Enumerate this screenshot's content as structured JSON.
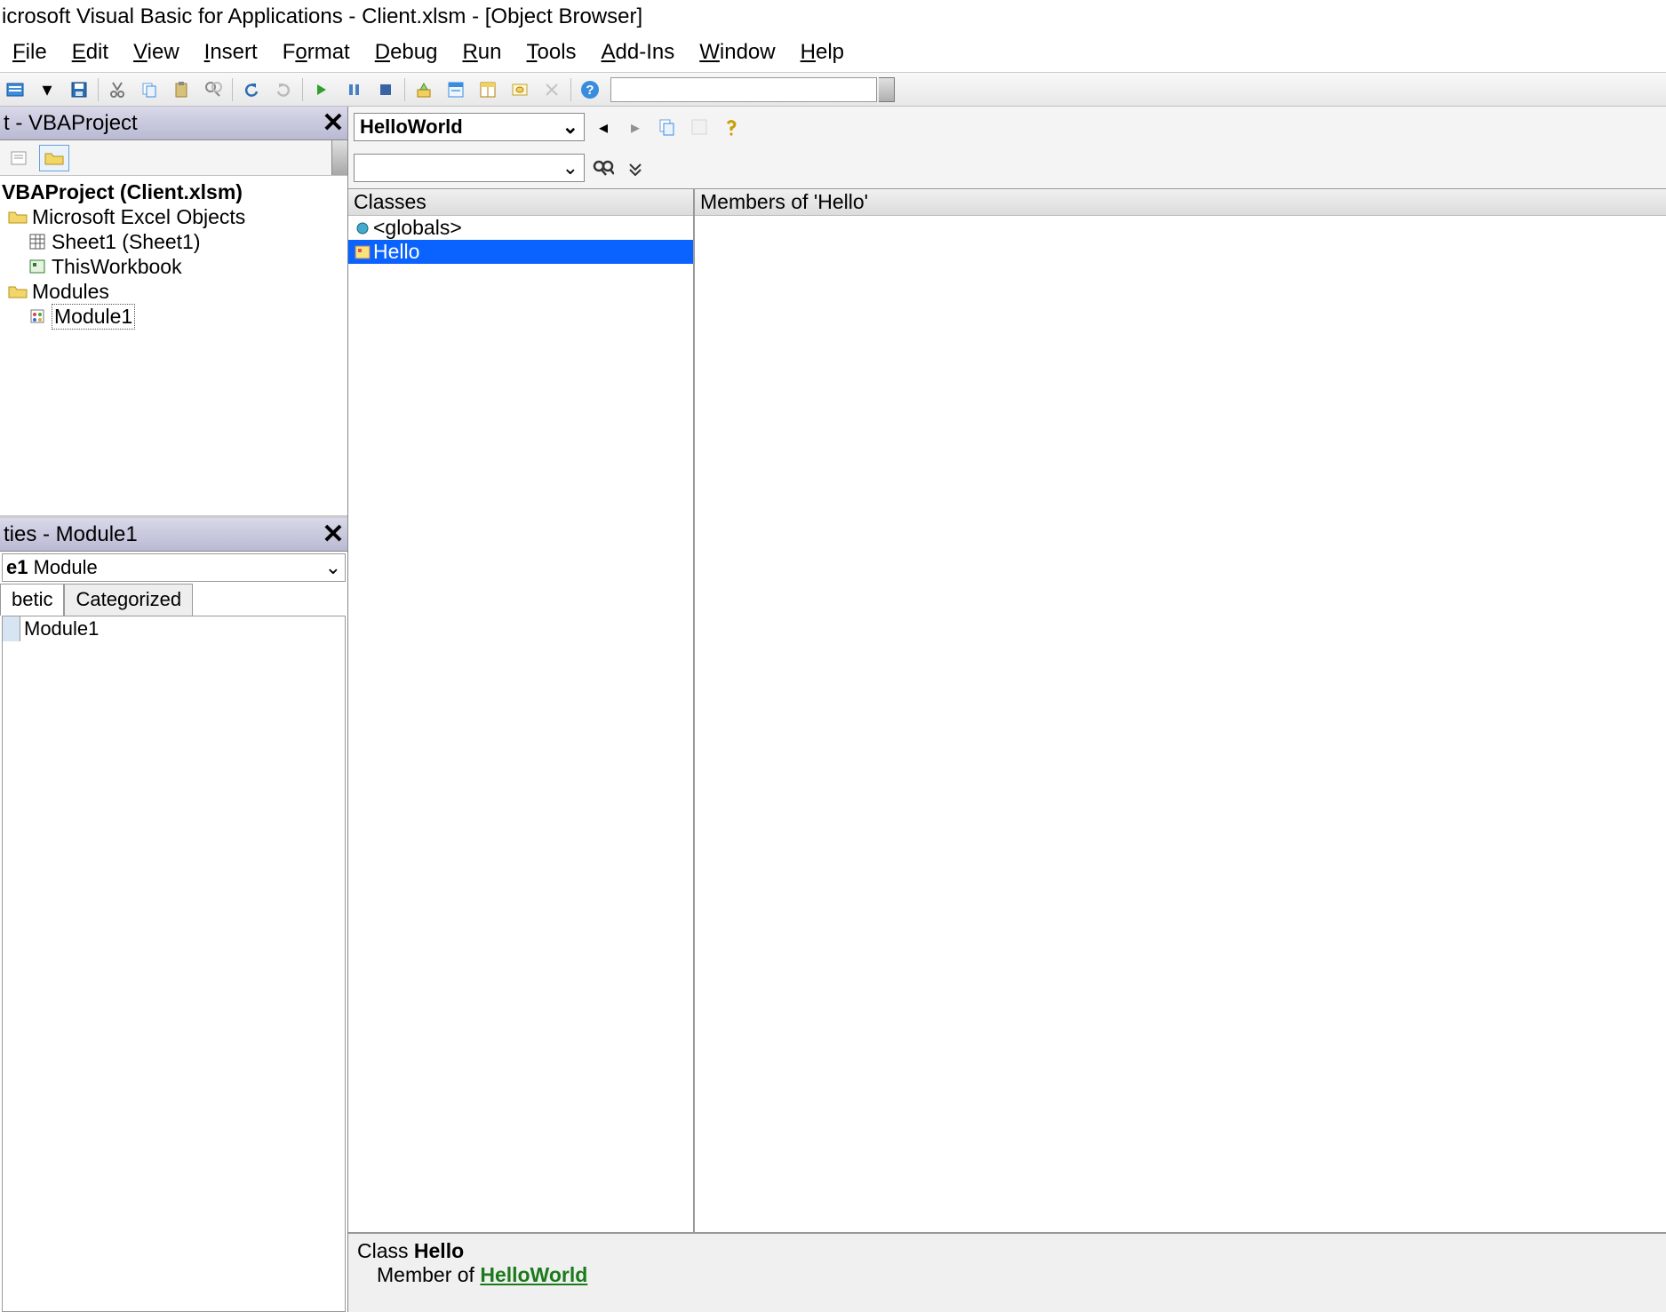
{
  "title": "icrosoft Visual Basic for Applications - Client.xlsm - [Object Browser]",
  "menu": {
    "file": "File",
    "edit": "Edit",
    "view": "View",
    "insert": "Insert",
    "format": "Format",
    "debug": "Debug",
    "run": "Run",
    "tools": "Tools",
    "addins": "Add-Ins",
    "window": "Window",
    "help": "Help"
  },
  "project": {
    "pane_title": "t - VBAProject",
    "root": "VBAProject (Client.xlsm)",
    "excel_objects": "Microsoft Excel Objects",
    "sheet1": "Sheet1 (Sheet1)",
    "thisworkbook": "ThisWorkbook",
    "modules": "Modules",
    "module1": "Module1"
  },
  "properties": {
    "pane_title": "ties - Module1",
    "combo_name": "e1",
    "combo_type": "Module",
    "tab_alpha": "betic",
    "tab_cat": "Categorized",
    "name_value": "Module1"
  },
  "ob": {
    "library": "HelloWorld",
    "search": "",
    "classes_header": "Classes",
    "members_header": "Members of 'Hello'",
    "class_globals": "<globals>",
    "class_hello": "Hello",
    "details_class_label": "Class ",
    "details_class_name": "Hello",
    "details_member_prefix": "Member of ",
    "details_member_link": "HelloWorld"
  }
}
